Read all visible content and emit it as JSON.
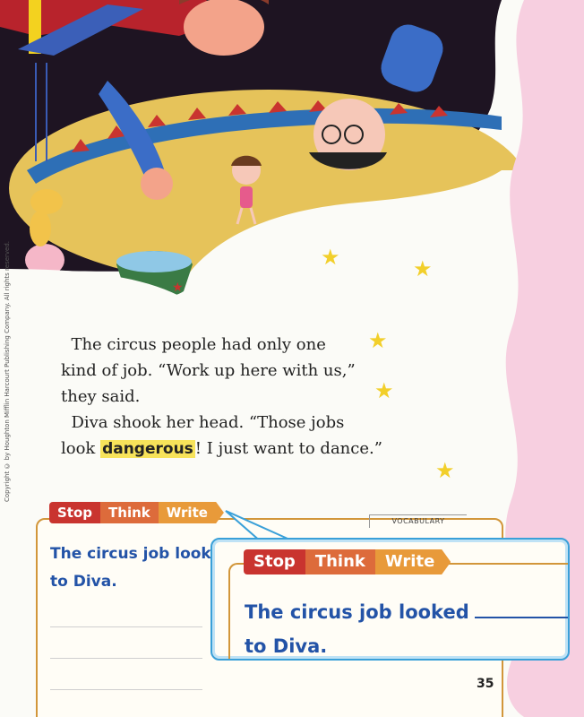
{
  "copyright": "Copyright © by Houghton Mifflin Harcourt Publishing Company. All rights reserved.",
  "story": {
    "para1": "The circus people had only one kind of job. “Work up here with us,” they said.",
    "para1_line1": "The circus people had only one",
    "para1_line2": "kind of job. “Work up here with us,”",
    "para1_line3": "they said.",
    "para2_line1": "Diva shook her head. “Those jobs",
    "para2_line2_before": "look ",
    "vocab_word": "dangerous",
    "para2_line2_after": "! I just want to dance.”"
  },
  "stw": {
    "tabs": [
      "Stop",
      "Think",
      "Write"
    ],
    "section_label": "VOCABULARY",
    "prompt_line1": "The circus job looked",
    "prompt_line2": "to Diva."
  },
  "page_number": "35",
  "colors": {
    "stop": "#c9342f",
    "think": "#dd6b3b",
    "write": "#e89a3a",
    "prompt_text": "#2353a7",
    "highlight": "#f7e35a",
    "callout_border": "#3aa0d8"
  }
}
